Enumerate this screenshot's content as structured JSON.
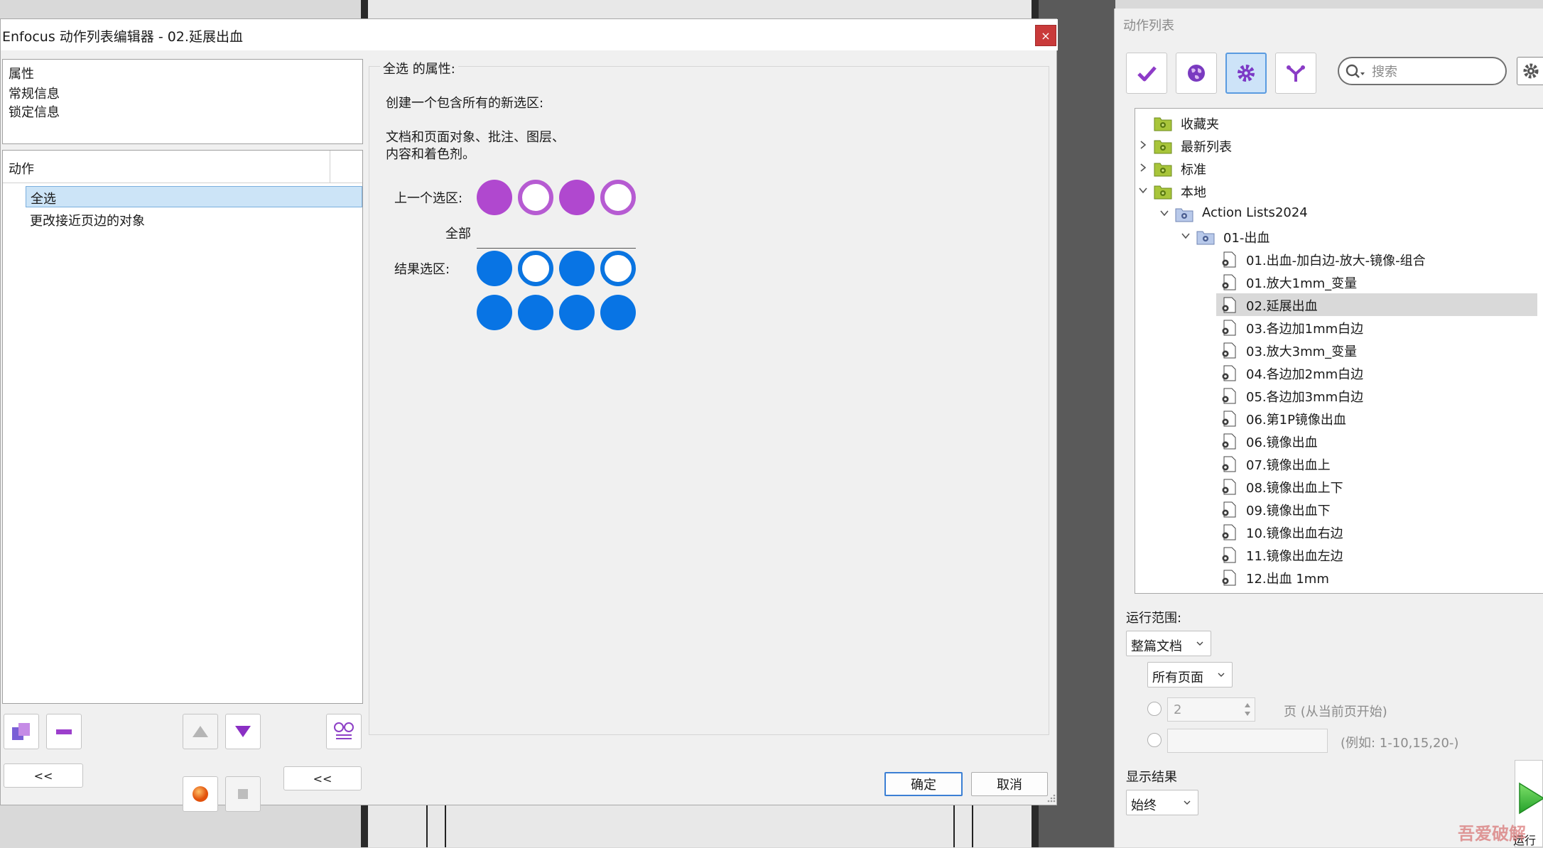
{
  "editor": {
    "title": "Enfocus 动作列表编辑器 - 02.延展出血",
    "close_glyph": "×",
    "properties": [
      "属性",
      "常规信息",
      "锁定信息"
    ],
    "actions_header": "动作",
    "actions": [
      "全选",
      "更改接近页边的对象"
    ],
    "back_left": "<<",
    "back_right": "<<",
    "group_title": "全选 的属性:",
    "desc_line1": "创建一个包含所有的新选区:",
    "desc_line2": "文档和页面对象、批注、图层、",
    "desc_line3": "内容和着色剂。",
    "prev_selection_label": "上一个选区:",
    "all_label": "全部",
    "result_selection_label": "结果选区:",
    "ok": "确定",
    "cancel": "取消"
  },
  "action_list": {
    "title": "动作列表",
    "search_placeholder": "搜索",
    "tree": [
      {
        "label": "收藏夹",
        "level": 0,
        "icon": "favorites-folder-icon"
      },
      {
        "label": "最新列表",
        "level": 0,
        "icon": "recent-folder-icon",
        "chevron": "right"
      },
      {
        "label": "标准",
        "level": 0,
        "icon": "standard-folder-icon",
        "chevron": "right"
      },
      {
        "label": "本地",
        "level": 0,
        "icon": "local-folder-icon",
        "chevron": "down"
      },
      {
        "label": "Action Lists2024",
        "level": 1,
        "icon": "action-folder-icon",
        "chevron": "down"
      },
      {
        "label": "01-出血",
        "level": 2,
        "icon": "action-folder-icon",
        "chevron": "down"
      },
      {
        "label": "01.出血-加白边-放大-镜像-组合",
        "level": 3,
        "icon": "action-file-icon"
      },
      {
        "label": "01.放大1mm_变量",
        "level": 3,
        "icon": "action-file-icon"
      },
      {
        "label": "02.延展出血",
        "level": 3,
        "icon": "action-file-icon",
        "selected": true
      },
      {
        "label": "03.各边加1mm白边",
        "level": 3,
        "icon": "action-file-icon"
      },
      {
        "label": "03.放大3mm_变量",
        "level": 3,
        "icon": "action-file-icon"
      },
      {
        "label": "04.各边加2mm白边",
        "level": 3,
        "icon": "action-file-icon"
      },
      {
        "label": "05.各边加3mm白边",
        "level": 3,
        "icon": "action-file-icon"
      },
      {
        "label": "06.第1P镜像出血",
        "level": 3,
        "icon": "action-file-icon"
      },
      {
        "label": "06.镜像出血",
        "level": 3,
        "icon": "action-file-icon"
      },
      {
        "label": "07.镜像出血上",
        "level": 3,
        "icon": "action-file-icon"
      },
      {
        "label": "08.镜像出血上下",
        "level": 3,
        "icon": "action-file-icon"
      },
      {
        "label": "09.镜像出血下",
        "level": 3,
        "icon": "action-file-icon"
      },
      {
        "label": "10.镜像出血右边",
        "level": 3,
        "icon": "action-file-icon"
      },
      {
        "label": "11.镜像出血左边",
        "level": 3,
        "icon": "action-file-icon"
      },
      {
        "label": "12.出血 1mm",
        "level": 3,
        "icon": "action-file-icon"
      }
    ],
    "run_scope_label": "运行范围:",
    "scope_value": "整篇文档",
    "pages_value": "所有页面",
    "page_count_value": "2",
    "page_unit": "页 (从当前页开始)",
    "range_example": "(例如: 1-10,15,20-)",
    "show_result_label": "显示结果",
    "show_result_value": "始终",
    "run_label": "运行"
  },
  "watermark": "吾爱破解"
}
